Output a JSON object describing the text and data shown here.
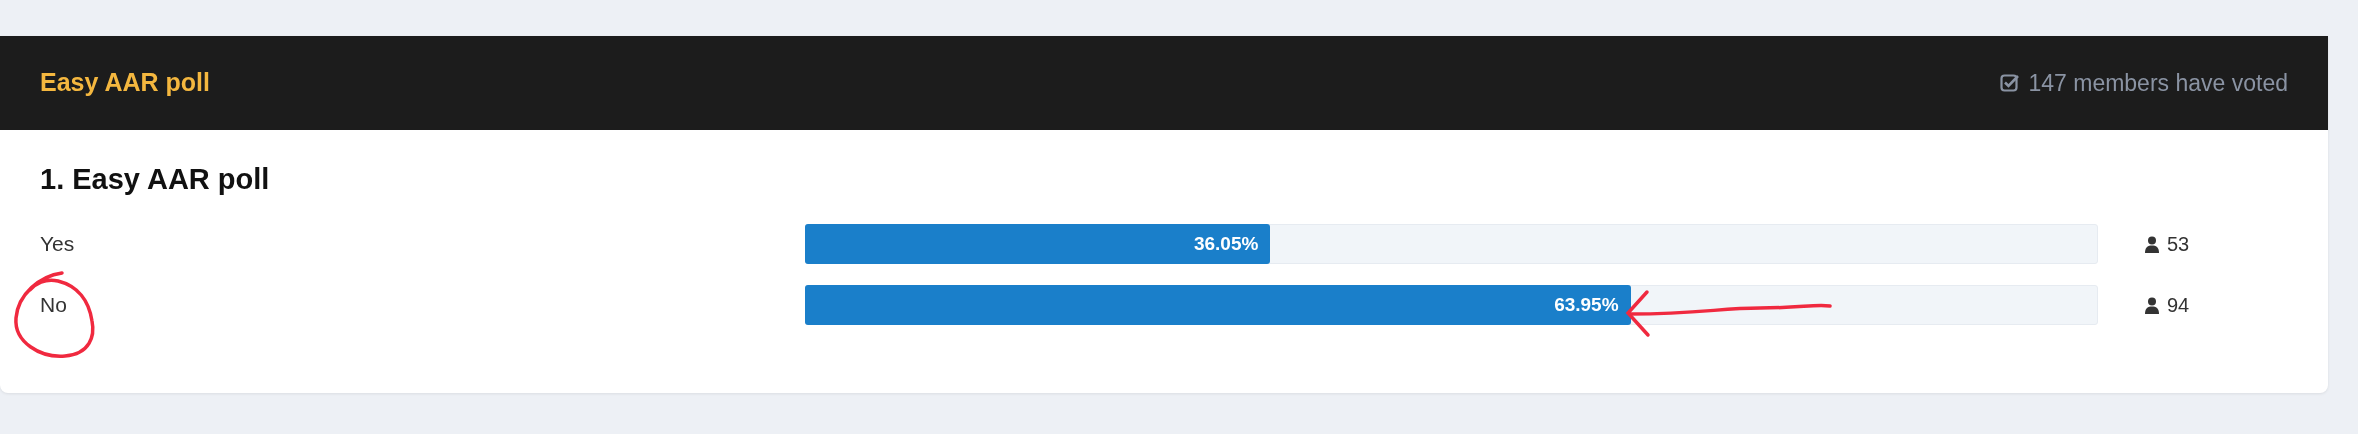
{
  "poll": {
    "title": "Easy AAR poll",
    "voted": "147 members have voted"
  },
  "question": {
    "title": "1. Easy AAR poll",
    "options": [
      {
        "label": "Yes",
        "level": 0.3605,
        "percent": "36.05%",
        "votes": "53"
      },
      {
        "label": "No",
        "level": 0.6395,
        "percent": "63.95%",
        "votes": "94"
      }
    ]
  }
}
